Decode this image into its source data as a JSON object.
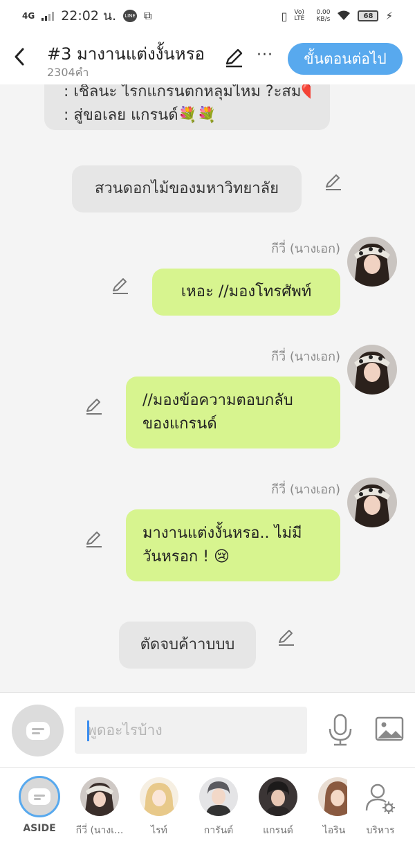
{
  "status_bar": {
    "network": "4G",
    "time": "22:02 น.",
    "data_speed": "0.00",
    "data_unit": "KB/s",
    "volte": "Vo) LTE",
    "battery": "68"
  },
  "header": {
    "title": "#3 มางานแต่งงั้นหรอ",
    "word_count": "2304คำ",
    "more_label": "···",
    "next_button": "ขั้นตอนต่อไป"
  },
  "messages": [
    {
      "type": "narration",
      "lines": [
        ": เชิลนะ ไรกแกรนตกหลุมไหม ?ะสม❤️",
        ": สู่ขอเลย แกรนด์💐💐"
      ]
    },
    {
      "type": "narration",
      "text": "สวนดอกไม้ของมหาวิทยาลัย"
    },
    {
      "type": "character",
      "name": "กีวี่ (นางเอก)",
      "text": "เหอะ //มองโทรศัพท์"
    },
    {
      "type": "character",
      "name": "กีวี่ (นางเอก)",
      "lines": [
        "//มองข้อความตอบกลับ",
        "ของแกรนด์"
      ]
    },
    {
      "type": "character",
      "name": "กีวี่ (นางเอก)",
      "lines": [
        "มางานแต่งงั้นหรอ.. ไม่มี",
        "วันหรอก ! 😢"
      ]
    },
    {
      "type": "narration",
      "text": "ตัดจบค้าาบบบ"
    }
  ],
  "input": {
    "placeholder": "พูดอะไรบ้าง"
  },
  "characters": [
    {
      "label": "ASIDE",
      "icon": "aside-icon",
      "active": true
    },
    {
      "label": "กีวี่ (นางเ...",
      "color": "#3a2e2a"
    },
    {
      "label": "ไรท์",
      "color": "#e8c98a"
    },
    {
      "label": "การันต์",
      "color": "#5b5b60"
    },
    {
      "label": "แกรนด์",
      "color": "#2a2626"
    },
    {
      "label": "ไอริน (",
      "color": "#8a5a40"
    },
    {
      "label": "บริหาร",
      "icon": "manage-user-icon"
    }
  ],
  "colors": {
    "accent": "#58a9ee",
    "character_bubble": "#d7f48f",
    "narration_bubble": "#e6e6e6"
  }
}
